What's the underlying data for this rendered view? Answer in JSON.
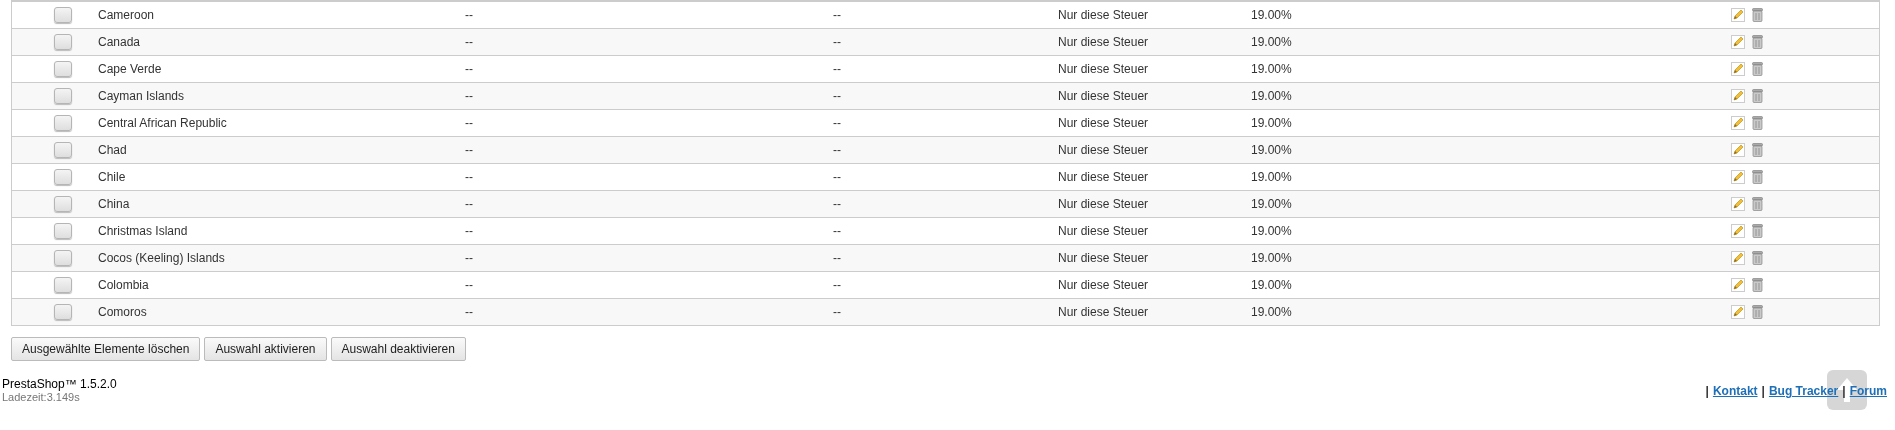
{
  "table": {
    "rows": [
      {
        "checked": false,
        "country": "Cameroon",
        "zip_range": "--",
        "description": "--",
        "behavior": "Nur diese Steuer",
        "tax": "19.00%"
      },
      {
        "checked": false,
        "country": "Canada",
        "zip_range": "--",
        "description": "--",
        "behavior": "Nur diese Steuer",
        "tax": "19.00%"
      },
      {
        "checked": false,
        "country": "Cape Verde",
        "zip_range": "--",
        "description": "--",
        "behavior": "Nur diese Steuer",
        "tax": "19.00%"
      },
      {
        "checked": false,
        "country": "Cayman Islands",
        "zip_range": "--",
        "description": "--",
        "behavior": "Nur diese Steuer",
        "tax": "19.00%"
      },
      {
        "checked": false,
        "country": "Central African Republic",
        "zip_range": "--",
        "description": "--",
        "behavior": "Nur diese Steuer",
        "tax": "19.00%"
      },
      {
        "checked": false,
        "country": "Chad",
        "zip_range": "--",
        "description": "--",
        "behavior": "Nur diese Steuer",
        "tax": "19.00%"
      },
      {
        "checked": false,
        "country": "Chile",
        "zip_range": "--",
        "description": "--",
        "behavior": "Nur diese Steuer",
        "tax": "19.00%"
      },
      {
        "checked": false,
        "country": "China",
        "zip_range": "--",
        "description": "--",
        "behavior": "Nur diese Steuer",
        "tax": "19.00%"
      },
      {
        "checked": false,
        "country": "Christmas Island",
        "zip_range": "--",
        "description": "--",
        "behavior": "Nur diese Steuer",
        "tax": "19.00%"
      },
      {
        "checked": false,
        "country": "Cocos (Keeling) Islands",
        "zip_range": "--",
        "description": "--",
        "behavior": "Nur diese Steuer",
        "tax": "19.00%"
      },
      {
        "checked": false,
        "country": "Colombia",
        "zip_range": "--",
        "description": "--",
        "behavior": "Nur diese Steuer",
        "tax": "19.00%"
      },
      {
        "checked": false,
        "country": "Comoros",
        "zip_range": "--",
        "description": "--",
        "behavior": "Nur diese Steuer",
        "tax": "19.00%"
      }
    ]
  },
  "bulk_actions": [
    "Ausgewählte Elemente löschen",
    "Auswahl aktivieren",
    "Auswahl deaktivieren"
  ],
  "footer": {
    "version": "PrestaShop™ 1.5.2.0",
    "load_time": "Ladezeit:3.149s",
    "separator": "|",
    "links": [
      "Kontakt",
      "Bug Tracker",
      "Forum"
    ]
  }
}
